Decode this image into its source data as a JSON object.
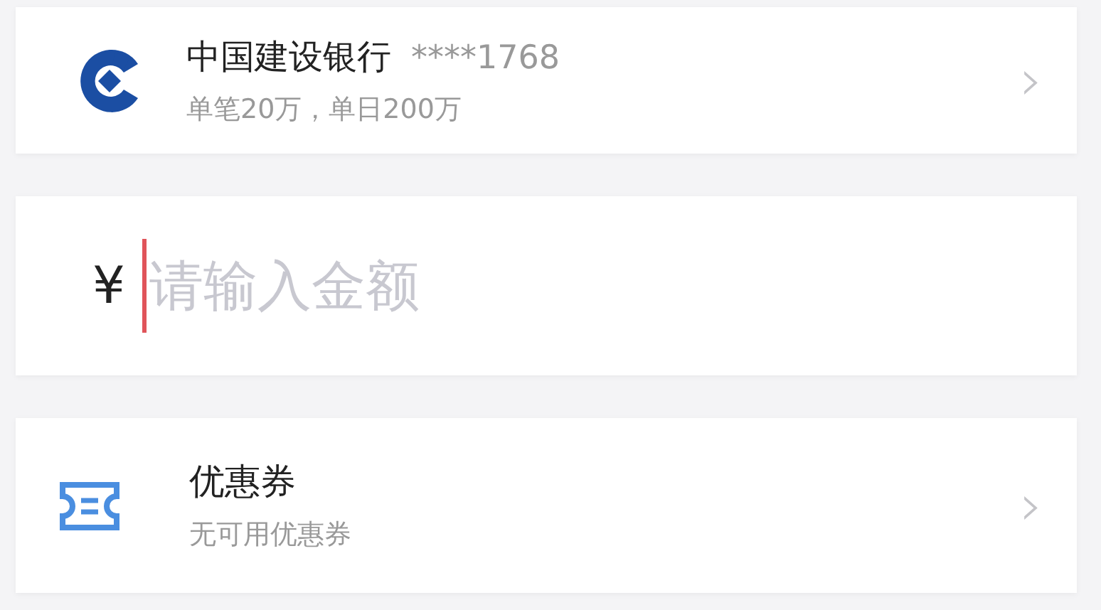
{
  "bank_card": {
    "name": "中国建设银行",
    "card_number": "****1768",
    "limit": "单笔20万，单日200万",
    "chevron": "›"
  },
  "amount": {
    "currency": "¥",
    "placeholder": "请输入金额"
  },
  "coupon": {
    "title": "优惠券",
    "subtitle": "无可用优惠券",
    "chevron": "›"
  }
}
